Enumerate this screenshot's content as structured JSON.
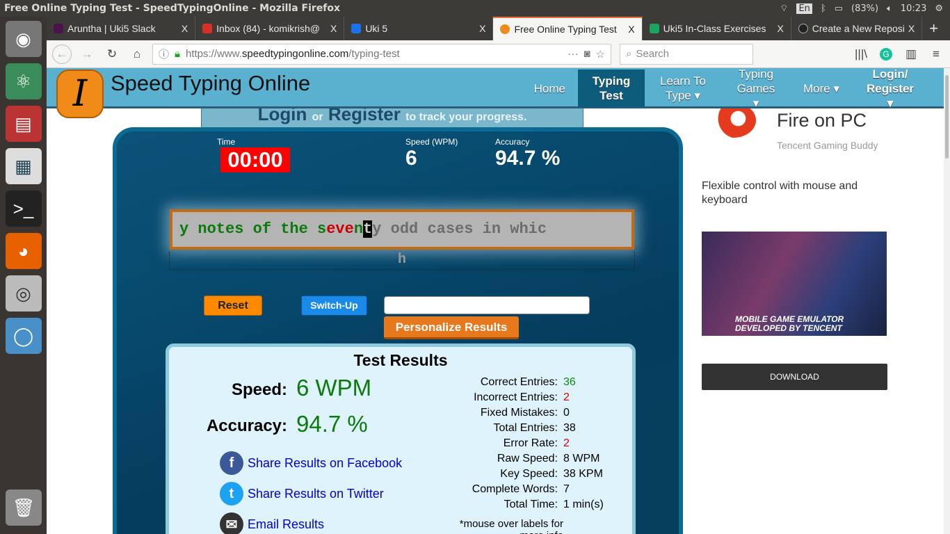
{
  "os": {
    "window_title": "Free Online Typing Test - SpeedTypingOnline - Mozilla Firefox",
    "keyboard": "En",
    "battery": "(83%)",
    "clock": "10:23"
  },
  "browser": {
    "tabs": [
      {
        "label": "Aruntha | Uki5 Slack",
        "color": "#4a154b",
        "active": false
      },
      {
        "label": "Inbox (84) - komikrish@",
        "color": "#d93025",
        "active": false
      },
      {
        "label": "Uki 5",
        "color": "#1a73e8",
        "active": false
      },
      {
        "label": "Free Online Typing Test",
        "color": "#f08a18",
        "active": true
      },
      {
        "label": "Uki5 In-Class Exercises",
        "color": "#1ea362",
        "active": false
      },
      {
        "label": "Create a New Repository",
        "color": "#222222",
        "active": false
      }
    ],
    "url_prefix": "https://www.",
    "url_host": "speedtypingonline.com",
    "url_path": "/typing-test",
    "search_placeholder": "Search"
  },
  "site": {
    "name": "Speed Typing Online",
    "menu": [
      "Home",
      "Typing Test",
      "Learn To Type ▾",
      "Typing Games ▾",
      "More ▾",
      "Login/ Register ▾"
    ],
    "login_bar": {
      "login": "Login",
      "or": "or",
      "register": "Register",
      "suffix": "to track your progress."
    }
  },
  "test": {
    "time_label": "Time",
    "time": "00:00",
    "speed_label": "Speed (WPM)",
    "speed": "6",
    "accuracy_label": "Accuracy",
    "accuracy": "94.7 %",
    "text": {
      "typed_a": "y notes of the s",
      "typed_err": "eve",
      "typed_b": "n",
      "cursor": "t",
      "rest": "y odd cases in whic",
      "next_line": "h"
    },
    "reset": "Reset",
    "switch_up": "Switch-Up",
    "personalize": "Personalize Results"
  },
  "results": {
    "title": "Test Results",
    "speed_label": "Speed:",
    "speed": "6 WPM",
    "accuracy_label": "Accuracy:",
    "accuracy": "94.7 %",
    "share": [
      "Share Results on Facebook",
      "Share Results on Twitter",
      "Email Results"
    ],
    "stats": [
      {
        "k": "Correct Entries:",
        "v": "36",
        "color": "#0a8a0a"
      },
      {
        "k": "Incorrect Entries:",
        "v": "2",
        "color": "#dd0000"
      },
      {
        "k": "Fixed Mistakes:",
        "v": "0",
        "color": "#000000"
      },
      {
        "k": "Total Entries:",
        "v": "38",
        "color": "#000000"
      },
      {
        "k": "Error Rate:",
        "v": "2",
        "color": "#dd0000"
      },
      {
        "k": "Raw Speed:",
        "v": "8 WPM",
        "color": "#000000"
      },
      {
        "k": "Key Speed:",
        "v": "38 KPM",
        "color": "#000000"
      },
      {
        "k": "Complete Words:",
        "v": "7",
        "color": "#000000"
      },
      {
        "k": "Total Time:",
        "v": "1 min(s)",
        "color": "#000000"
      }
    ],
    "note": "*mouse over labels for more info"
  },
  "ad": {
    "title": "Fire on PC",
    "sub": "Tencent Gaming Buddy",
    "desc": "Flexible control with mouse and keyboard",
    "banner": "MOBILE GAME EMULATOR DEVELOPED BY TENCENT",
    "button": "DOWNLOAD"
  }
}
